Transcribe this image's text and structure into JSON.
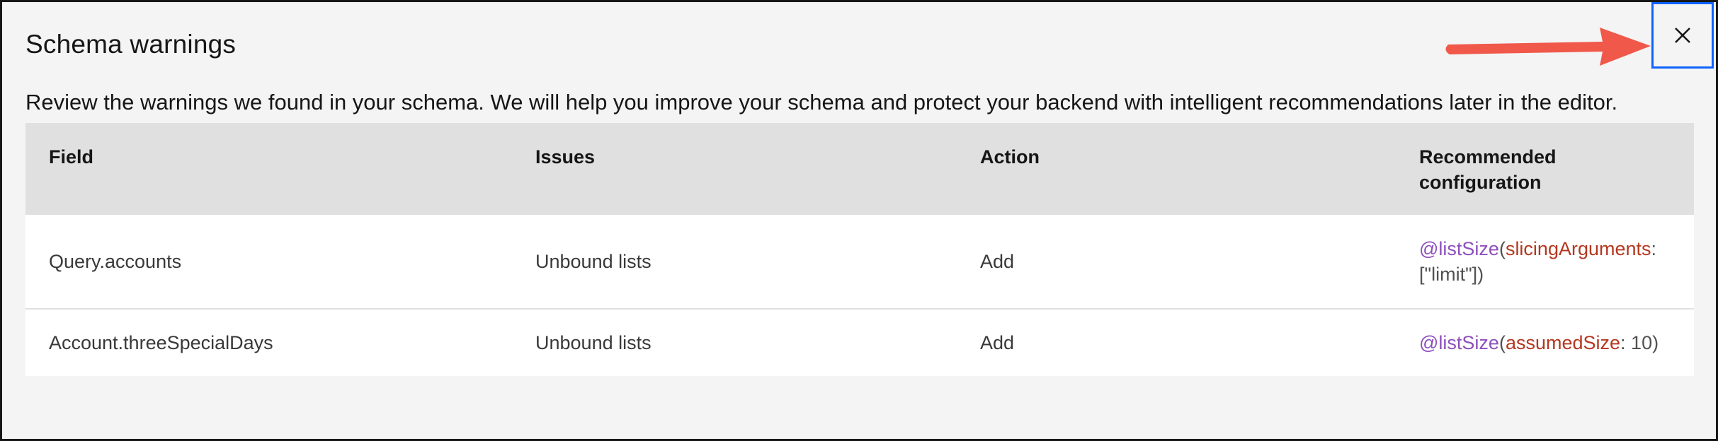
{
  "modal": {
    "title": "Schema warnings",
    "description": "Review the warnings we found in your schema. We will help you improve your schema and protect your backend with intelligent recommendations later in the editor.",
    "close_icon": "close-icon"
  },
  "table": {
    "headers": {
      "field": "Field",
      "issues": "Issues",
      "action": "Action",
      "recommended_line1": "Recommended",
      "recommended_line2": "configuration"
    },
    "rows": [
      {
        "field": "Query.accounts",
        "issues": "Unbound lists",
        "action": "Add",
        "rec": {
          "directive": "@listSize",
          "open": "(",
          "arg": "slicingArguments",
          "colon": ":",
          "value": "[\"limit\"])"
        }
      },
      {
        "field": "Account.threeSpecialDays",
        "issues": "Unbound lists",
        "action": "Add",
        "rec": {
          "directive": "@listSize",
          "open": "(",
          "arg": "assumedSize",
          "colon": ":",
          "value": " 10",
          "close": ")"
        }
      }
    ]
  },
  "colors": {
    "accent_focus": "#0f62fe",
    "annotation_arrow": "#f0584a",
    "directive": "#8e4fbb",
    "argument": "#b5371f"
  }
}
